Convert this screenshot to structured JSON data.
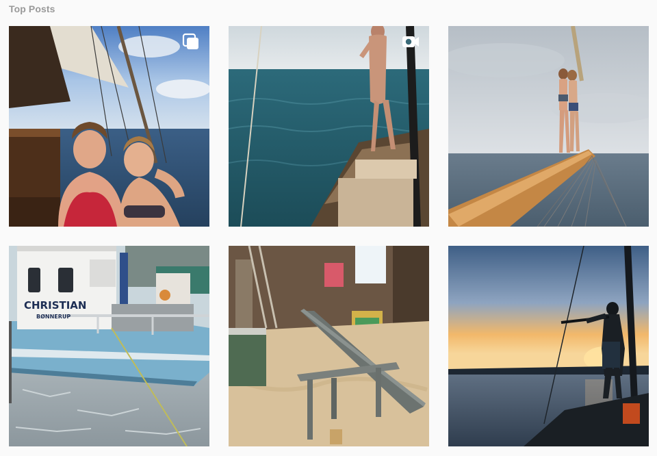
{
  "section": {
    "title": "Top Posts"
  },
  "posts": [
    {
      "id": "sailboat-friends",
      "badge": "carousel-icon"
    },
    {
      "id": "bow-standing",
      "badge": "video-icon"
    },
    {
      "id": "bowsprit-pair",
      "badge": ""
    },
    {
      "id": "fishing-boat-ice",
      "badge": "",
      "hull_name": "CHRISTIAN",
      "hull_port": "BØNNERUP"
    },
    {
      "id": "woodworking-shop",
      "badge": ""
    },
    {
      "id": "sunset-silhouette",
      "badge": ""
    }
  ]
}
